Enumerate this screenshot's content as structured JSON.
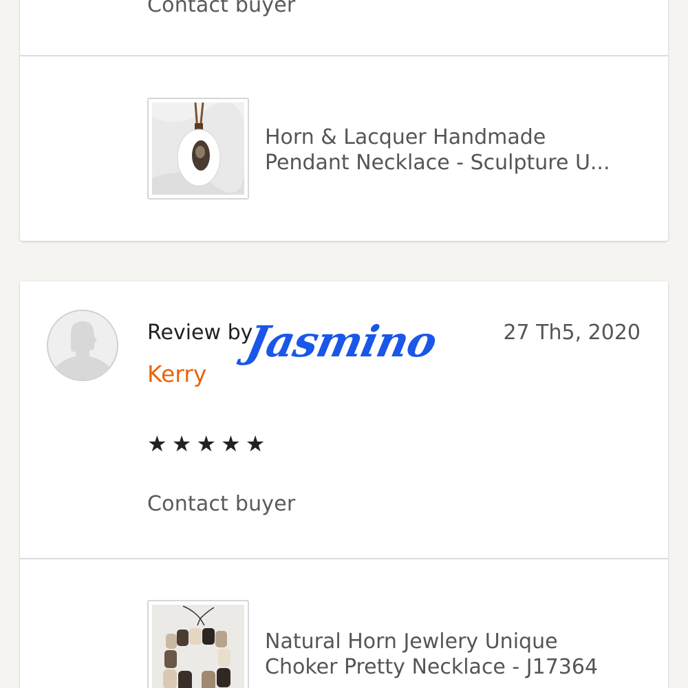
{
  "top_card": {
    "contact_label": "Contact buyer",
    "listing": {
      "title_line1": "Horn & Lacquer Handmade",
      "title_line2": "Pendant Necklace - Sculpture U..."
    }
  },
  "review_card": {
    "review_by_label": "Review by",
    "reviewer_name": "Kerry",
    "date": "27 Th5, 2020",
    "stars": "★★★★★",
    "rating": 5,
    "contact_label": "Contact buyer",
    "listing": {
      "title_line1": "Natural Horn Jewlery Unique",
      "title_line2": "Choker Pretty Necklace  - J17364"
    }
  },
  "watermark": "Jasmino",
  "colors": {
    "accent": "#e8650a",
    "watermark": "#1a56e8",
    "background": "#f5f4f0"
  }
}
